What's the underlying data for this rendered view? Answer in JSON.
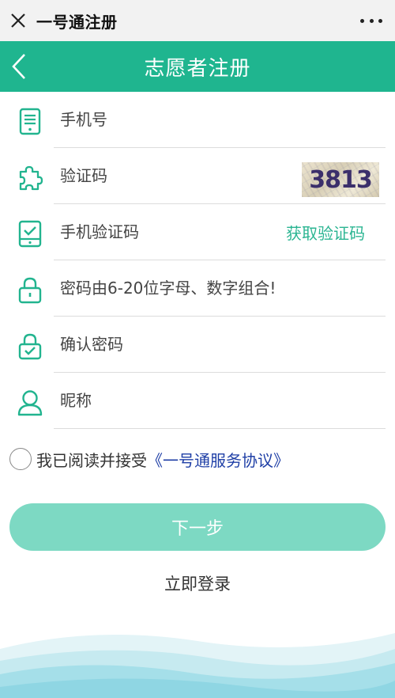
{
  "topbar": {
    "title": "一号通注册"
  },
  "header": {
    "title": "志愿者注册"
  },
  "form": {
    "phone_placeholder": "手机号",
    "captcha_placeholder": "验证码",
    "captcha_code": "3813",
    "sms_placeholder": "手机验证码",
    "get_code_label": "获取验证码",
    "password_placeholder": "密码由6-20位字母、数字组合!",
    "confirm_placeholder": "确认密码",
    "nickname_placeholder": "昵称"
  },
  "agreement": {
    "text": "我已阅读并接受",
    "link": "《一号通服务协议》"
  },
  "buttons": {
    "next": "下一步",
    "login": "立即登录"
  },
  "colors": {
    "brand": "#1fb58f",
    "button": "#7dd9c3",
    "link": "#1f3fa6"
  }
}
